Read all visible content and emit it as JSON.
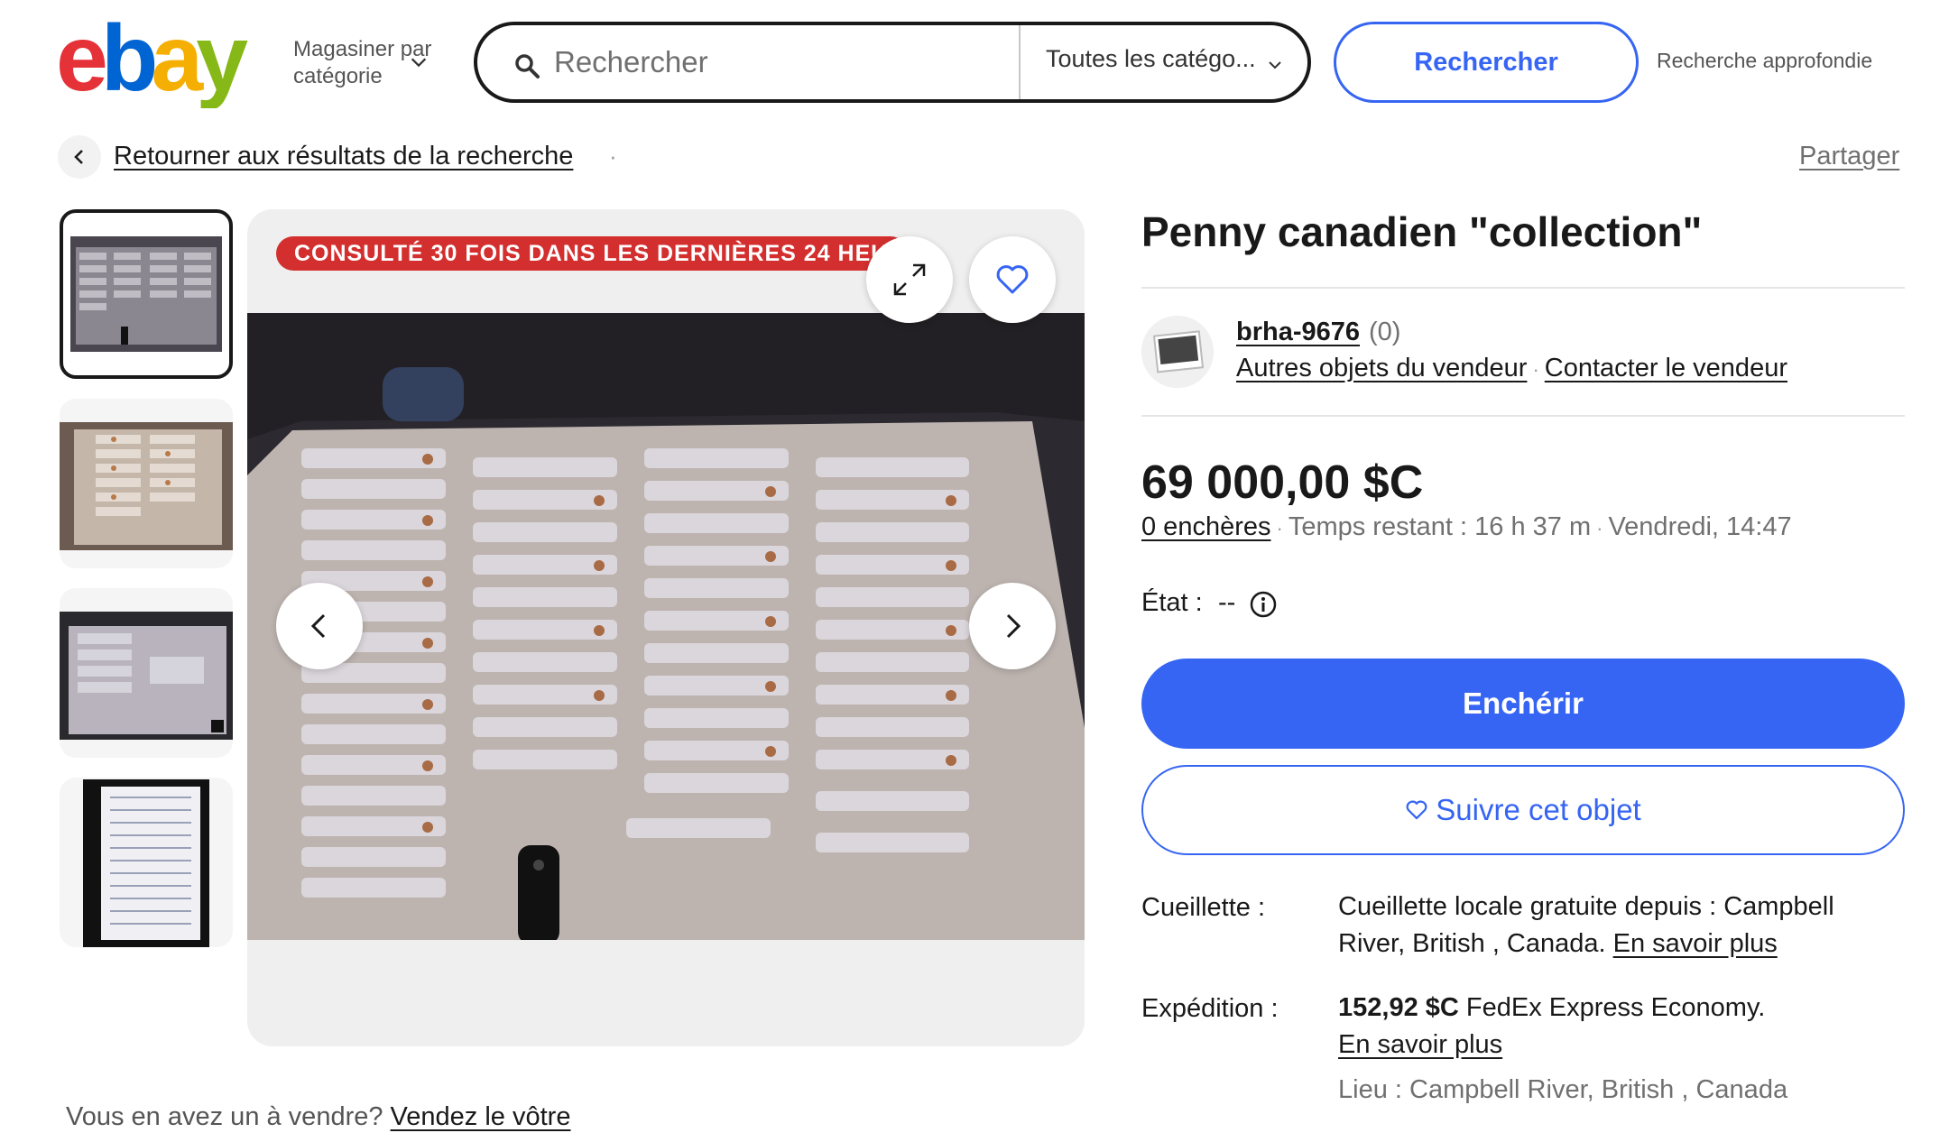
{
  "header": {
    "logo_text": "ebay",
    "shop_by_category": "Magasiner par catégorie",
    "search_placeholder": "Rechercher",
    "category_select": "Toutes les catégo...",
    "search_button": "Rechercher",
    "advanced_search": "Recherche approfondie"
  },
  "breadcrumb": {
    "back_label": "Retourner aux résultats de la recherche",
    "share_label": "Partager"
  },
  "gallery": {
    "views_badge": "CONSULTÉ 30 FOIS DANS LES DERNIÈRES 24 HEURES",
    "thumbnail_count": 4,
    "active_thumbnail": 1
  },
  "listing": {
    "title": "Penny canadien \"collection\"",
    "seller": {
      "name": "brha-9676",
      "feedback": "(0)",
      "other_items": "Autres objets du vendeur",
      "contact": "Contacter le vendeur"
    },
    "price": "69 000,00 $C",
    "bids": "0 enchères",
    "time_left": "Temps restant : 16 h 37 m",
    "end_time": "Vendredi, 14:47",
    "condition_label": "État :",
    "condition_value": "--",
    "bid_button": "Enchérir",
    "watch_button": "Suivre cet objet",
    "pickup": {
      "label": "Cueillette :",
      "text": "Cueillette locale gratuite depuis : Campbell River, British , Canada.",
      "link": "En savoir plus"
    },
    "shipping": {
      "label": "Expédition :",
      "price": "152,92 $C",
      "service": "FedEx Express Economy.",
      "link": "En savoir plus",
      "location": "Lieu : Campbell River, British , Canada"
    }
  },
  "footer": {
    "sell_prompt": "Vous en avez un à vendre?",
    "sell_link": "Vendez le vôtre"
  },
  "colors": {
    "ebay_red": "#e53238",
    "ebay_blue": "#0064d2",
    "ebay_yellow": "#f5af02",
    "ebay_green": "#86b817",
    "primary_blue": "#3665f3",
    "badge_red": "#d32f2f"
  }
}
